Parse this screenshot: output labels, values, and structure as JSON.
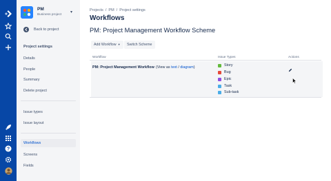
{
  "global_nav": {
    "icons": [
      "jira-logo-icon",
      "star-icon",
      "search-icon",
      "create-plus-icon",
      "rocket-icon",
      "app-switcher-icon",
      "help-icon",
      "settings-gear-icon",
      "user-avatar"
    ]
  },
  "project": {
    "name": "PM",
    "type": "Business project"
  },
  "sidebar": {
    "back_label": "Back to project",
    "section_title": "Project settings",
    "group1": [
      "Details",
      "People",
      "Summary",
      "Delete project"
    ],
    "group2": [
      "Issue types",
      "Issue layout"
    ],
    "group3": [
      "Workflows",
      "Screens",
      "Fields"
    ],
    "active_item": "Workflows"
  },
  "breadcrumbs": [
    "Projects",
    "PM",
    "Project settings"
  ],
  "page_title": "Workflows",
  "scheme_title": "PM: Project Management Workflow Scheme",
  "toolbar": {
    "add_workflow": "Add Workflow",
    "switch_scheme": "Switch Scheme"
  },
  "table": {
    "headers": [
      "Workflow",
      "Issue Types",
      "Actions"
    ],
    "workflow_name": "PM: Project Management Workflow",
    "view_prefix": "(View as",
    "view_text_link": "text",
    "view_separator": "/",
    "view_diagram_link": "diagram",
    "view_suffix": ")",
    "issue_types": [
      {
        "name": "Story",
        "color": "#63ba3c"
      },
      {
        "name": "Bug",
        "color": "#e5493a"
      },
      {
        "name": "Epic",
        "color": "#904ee2"
      },
      {
        "name": "Task",
        "color": "#4bade8"
      },
      {
        "name": "Sub-task",
        "color": "#4bade8"
      }
    ]
  },
  "colors": {
    "nav_rail": "#0747a6",
    "sidebar_bg": "#f4f5f7",
    "link": "#0052cc",
    "text": "#172b4d"
  }
}
